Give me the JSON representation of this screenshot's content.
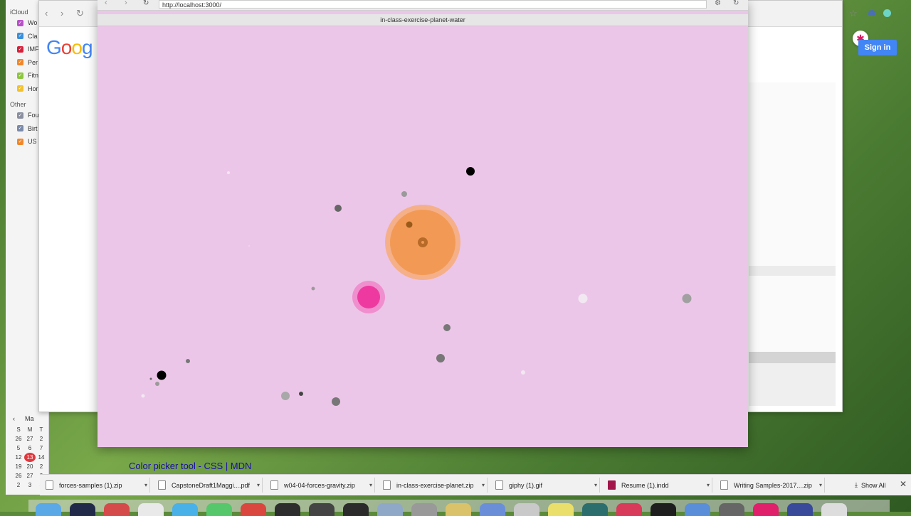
{
  "calendar": {
    "section_icloud": "iCloud",
    "icloud_items": [
      {
        "label": "Wo",
        "color": "#b84fc8"
      },
      {
        "label": "Cla",
        "color": "#3b8fd9"
      },
      {
        "label": "IMF",
        "color": "#d6203a"
      },
      {
        "label": "Per",
        "color": "#f0872a"
      },
      {
        "label": "Fitn",
        "color": "#8cc63f"
      },
      {
        "label": "Hor",
        "color": "#f2c12e"
      }
    ],
    "section_other": "Other",
    "other_items": [
      {
        "label": "Fou",
        "color": "#8a8fa0"
      },
      {
        "label": "Birt",
        "color": "#7a8aa8"
      },
      {
        "label": "US",
        "color": "#f0872a"
      }
    ],
    "mini_month": "Ma",
    "mini_prev": "‹",
    "mini_header": [
      "S",
      "M",
      "T"
    ],
    "mini_rows": [
      [
        "26",
        "27",
        "2"
      ],
      [
        "5",
        "6",
        "7"
      ],
      [
        "12",
        "13",
        "14"
      ],
      [
        "19",
        "20",
        "2"
      ],
      [
        "26",
        "27",
        "2"
      ],
      [
        "2",
        "3",
        "4"
      ]
    ],
    "today": "13"
  },
  "chrome": {
    "google_logo": [
      "G",
      "o",
      "o",
      "g"
    ],
    "google_colors": [
      "#4285f4",
      "#ea4335",
      "#fbbc05",
      "#4285f4"
    ],
    "sign_in": "Sign in",
    "gear": "✱",
    "nav_back": "‹",
    "nav_forward": "›",
    "reload": "↻",
    "star": "☆"
  },
  "sketch": {
    "url": "http://localhost:3000/",
    "title": "in-class-exercise-planet-water",
    "background": "#ecc6e8",
    "sun": {
      "label": "sun",
      "color": "#f29a55",
      "halo": "#f5b08a"
    },
    "planet": {
      "label": "planet",
      "color": "#ee3aa0",
      "halo": "#f08fce"
    },
    "particles_count": 25
  },
  "status": {
    "link_text": "Color picker tool - CSS | MDN"
  },
  "downloads": {
    "items": [
      {
        "name": "forces-samples (1).zip"
      },
      {
        "name": "CapstoneDraft1Maggi....pdf"
      },
      {
        "name": "w04-04-forces-gravity.zip"
      },
      {
        "name": "in-class-exercise-planet.zip"
      },
      {
        "name": "giphy (1).gif"
      },
      {
        "name": "Resume (1).indd"
      },
      {
        "name": "Writing Samples-2017....zip"
      }
    ],
    "show_all": "Show All",
    "close": "✕"
  }
}
